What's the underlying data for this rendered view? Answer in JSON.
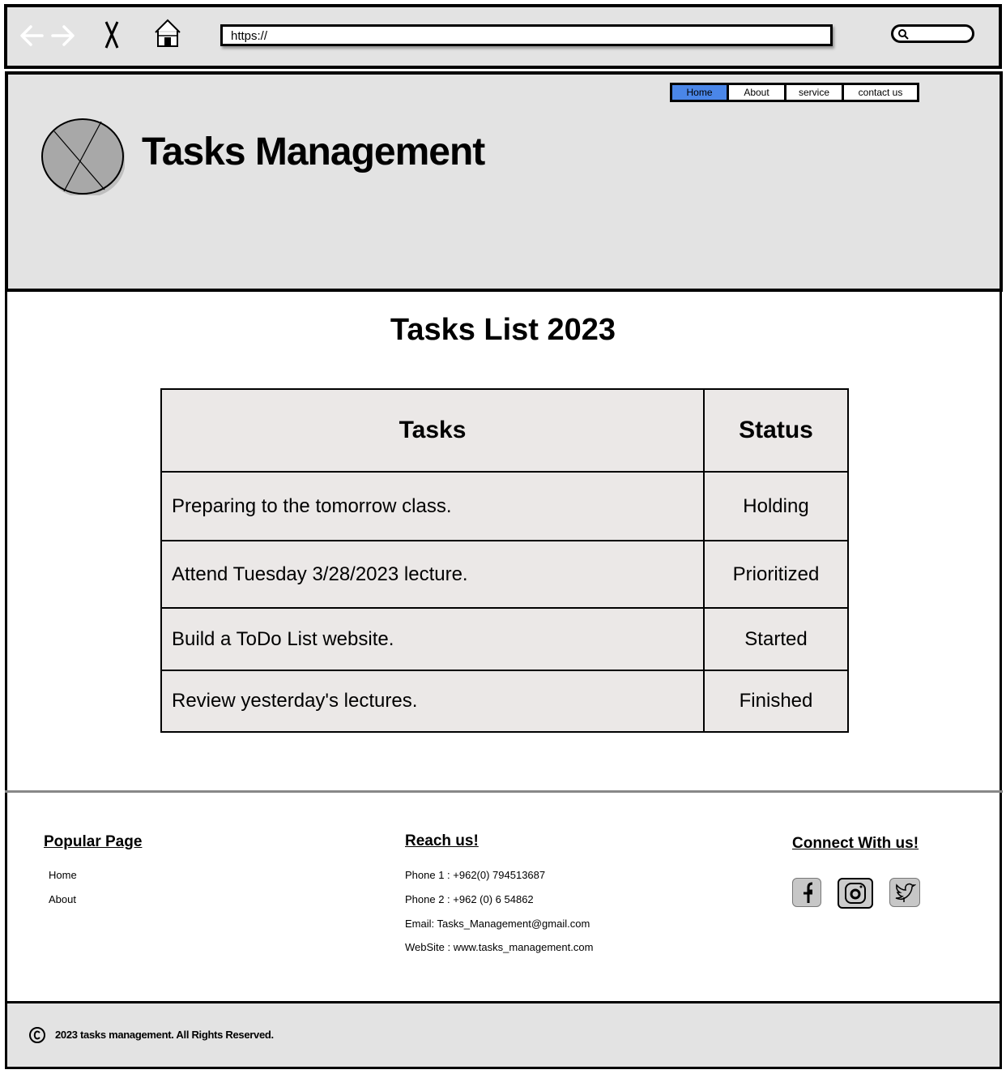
{
  "browser": {
    "url": "https://",
    "icons": [
      "back-arrow-icon",
      "forward-arrow-icon",
      "close-icon",
      "home-icon",
      "search-icon"
    ]
  },
  "header": {
    "title": "Tasks Management",
    "nav": [
      {
        "label": "Home",
        "active": true
      },
      {
        "label": "About",
        "active": false
      },
      {
        "label": "service",
        "active": false
      },
      {
        "label": "contact us",
        "active": false
      }
    ],
    "accent_color": "#4a86e8"
  },
  "main": {
    "title": "Tasks List 2023",
    "table": {
      "headers": [
        "Tasks",
        "Status"
      ],
      "rows": [
        {
          "task": "Preparing to the tomorrow class.",
          "status": "Holding"
        },
        {
          "task": "Attend Tuesday  3/28/2023 lecture.",
          "status": "Prioritized"
        },
        {
          "task": "Build a ToDo List website.",
          "status": "Started"
        },
        {
          "task": "Review yesterday's lectures.",
          "status": "Finished"
        }
      ]
    }
  },
  "footer": {
    "popular": {
      "heading": "Popular Page",
      "links": [
        "Home",
        "About"
      ]
    },
    "reach": {
      "heading": "Reach us!",
      "lines": [
        "Phone 1 : +962(0) 794513687",
        "Phone 2 : +962 (0) 6 54862",
        "Email: Tasks_Management@gmail.com",
        "WebSite : www.tasks_management.com"
      ]
    },
    "connect": {
      "heading": "Connect With us!",
      "icons": [
        "facebook-icon",
        "instagram-icon",
        "twitter-icon"
      ]
    },
    "copyright": "2023 tasks management. All Rights Reserved."
  }
}
